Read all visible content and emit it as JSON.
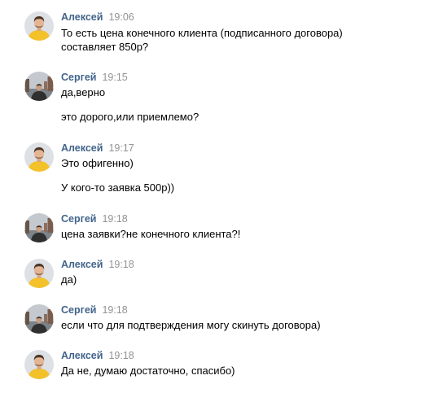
{
  "messages": [
    {
      "author": "Алексей",
      "time": "19:06",
      "lines": [
        "То есть цена конечного клиента (подписанного договора)",
        "составляет 850р?"
      ]
    },
    {
      "author": "Сергей",
      "time": "19:15",
      "lines": [
        "да,верно",
        "это дорого,или приемлемо?"
      ]
    },
    {
      "author": "Алексей",
      "time": "19:17",
      "lines": [
        "Это офигенно)",
        "У кого-то заявка 500р))"
      ]
    },
    {
      "author": "Сергей",
      "time": "19:18",
      "lines": [
        "цена заявки?не конечного клиента?!"
      ]
    },
    {
      "author": "Алексей",
      "time": "19:18",
      "lines": [
        "да)"
      ]
    },
    {
      "author": "Сергей",
      "time": "19:18",
      "lines": [
        "если что для подтверждения могу скинуть договора)"
      ]
    },
    {
      "author": "Алексей",
      "time": "19:18",
      "lines": [
        "Да не, думаю достаточно, спасибо)"
      ]
    }
  ],
  "colors": {
    "author_name": "#42648b",
    "timestamp": "#939393",
    "message_text": "#000000",
    "avatar_aleksey": "#f3c12a",
    "avatar_sergey": "#3a3a3a"
  },
  "icons": {
    "avatar_aleksey": "user-avatar-photo",
    "avatar_sergey": "user-avatar-photo"
  }
}
